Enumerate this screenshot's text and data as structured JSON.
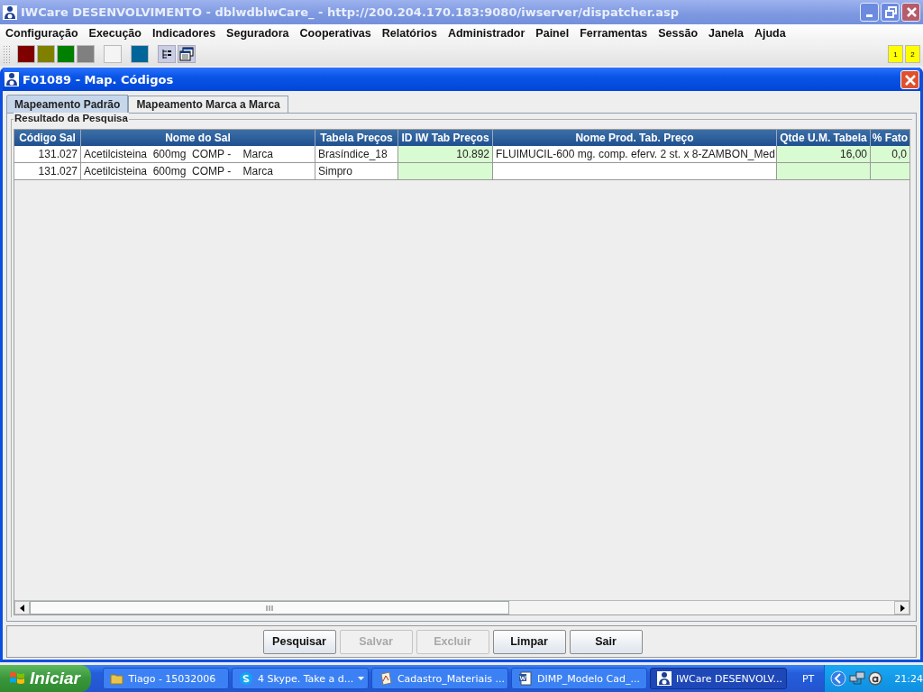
{
  "window": {
    "title": "IWCare DESENVOLVIMENTO - dblwdblwCare_ - http://200.204.170.183:9080/iwserver/dispatcher.asp"
  },
  "menu": [
    "Configuração",
    "Execução",
    "Indicadores",
    "Seguradora",
    "Cooperativas",
    "Relatórios",
    "Administrador",
    "Painel",
    "Ferramentas",
    "Sessão",
    "Janela",
    "Ajuda"
  ],
  "toolbar": {
    "swatches": [
      {
        "color": "#800000"
      },
      {
        "color": "#808000"
      },
      {
        "color": "#008000"
      },
      {
        "color": "#808080"
      },
      {
        "color": "#f4f4f4"
      },
      {
        "color": "#006699"
      }
    ],
    "pages": [
      "1",
      "2"
    ]
  },
  "frame": {
    "title": "F01089 - Map. Códigos",
    "tabs": [
      {
        "label": "Mapeamento Padrão",
        "selected": true
      },
      {
        "label": "Mapeamento Marca a Marca",
        "selected": false
      }
    ],
    "group": {
      "title": "Resultado da Pesquisa",
      "table": {
        "columns": [
          {
            "label": "Código Sal",
            "kind": "number",
            "editable": false
          },
          {
            "label": "Nome do Sal",
            "kind": "text",
            "editable": false
          },
          {
            "label": "Tabela Preços",
            "kind": "text",
            "editable": false
          },
          {
            "label": "ID IW Tab Preços",
            "kind": "number",
            "editable": true
          },
          {
            "label": "Nome Prod. Tab. Preço",
            "kind": "text",
            "editable": false
          },
          {
            "label": "Qtde U.M. Tabela",
            "kind": "number",
            "editable": true
          },
          {
            "label": "% Fato",
            "kind": "number",
            "editable": true
          }
        ],
        "rows": [
          [
            "131.027",
            "Acetilcisteina  600mg  COMP -    Marca",
            "Brasíndice_18",
            "10.892",
            "FLUIMUCIL-600 mg. comp. eferv. 2 st. x 8-ZAMBON_Med",
            "16,00",
            "0,0"
          ],
          [
            "131.027",
            "Acetilcisteina  600mg  COMP -    Marca",
            "Simpro",
            "",
            "",
            "",
            ""
          ]
        ]
      }
    },
    "buttons": [
      {
        "label": "Pesquisar",
        "disabled": false
      },
      {
        "label": "Salvar",
        "disabled": true
      },
      {
        "label": "Excluir",
        "disabled": true
      },
      {
        "label": "Limpar",
        "disabled": false
      },
      {
        "label": "Sair",
        "disabled": false
      }
    ]
  },
  "taskbar": {
    "start": "Iniciar",
    "items": [
      {
        "label": "Tiago - 15032006",
        "kind": "folder",
        "selected": false
      },
      {
        "label": "4 Skype. Take a d...",
        "kind": "skype",
        "selected": false
      },
      {
        "label": "Cadastro_Materiais ...",
        "kind": "document",
        "selected": false
      },
      {
        "label": "DIMP_Modelo Cad_...",
        "kind": "word",
        "selected": false
      },
      {
        "label": "IWCare DESENVOLV...",
        "kind": "app",
        "selected": true
      }
    ],
    "language": "PT",
    "clock": "21:24"
  }
}
